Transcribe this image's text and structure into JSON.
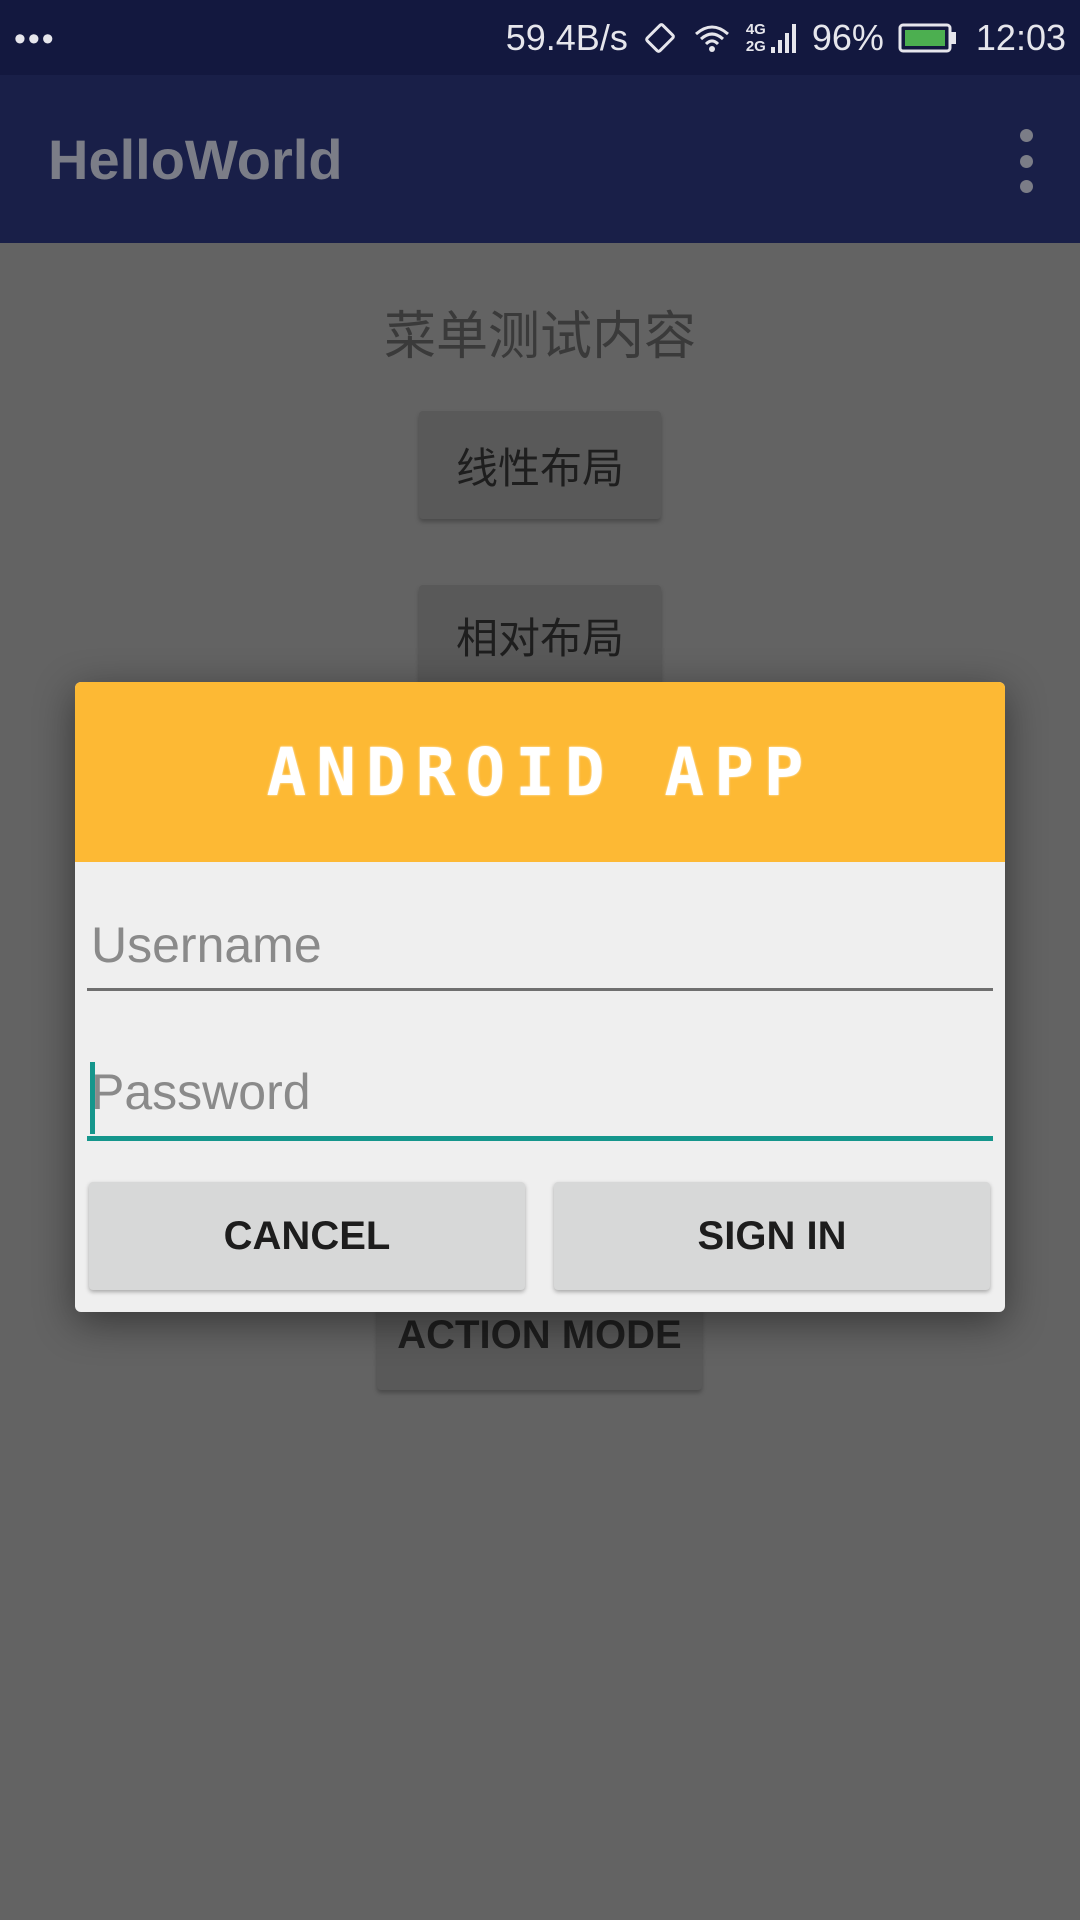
{
  "status_bar": {
    "network_speed": "59.4B/s",
    "network_type_top": "4G",
    "network_type_bottom": "2G",
    "battery_percent": "96%",
    "time": "12:03",
    "colors": {
      "background": "#13183f",
      "battery_fill": "#4caf50"
    }
  },
  "app_bar": {
    "title": "HelloWorld",
    "overflow_icon": "more-vert-icon",
    "colors": {
      "background": "#191f48"
    }
  },
  "content": {
    "title": "菜单测试内容",
    "buttons": [
      {
        "label": "线性布局"
      },
      {
        "label": "相对布局"
      },
      {
        "label": "ACTION MODE"
      }
    ]
  },
  "dialog": {
    "header_text": "ANDROID APP",
    "username": {
      "placeholder": "Username",
      "value": ""
    },
    "password": {
      "placeholder": "Password",
      "value": ""
    },
    "cancel_label": "CANCEL",
    "sign_in_label": "SIGN IN",
    "colors": {
      "header": "#fdb934",
      "accent": "#15968c",
      "background": "#efefef"
    }
  }
}
